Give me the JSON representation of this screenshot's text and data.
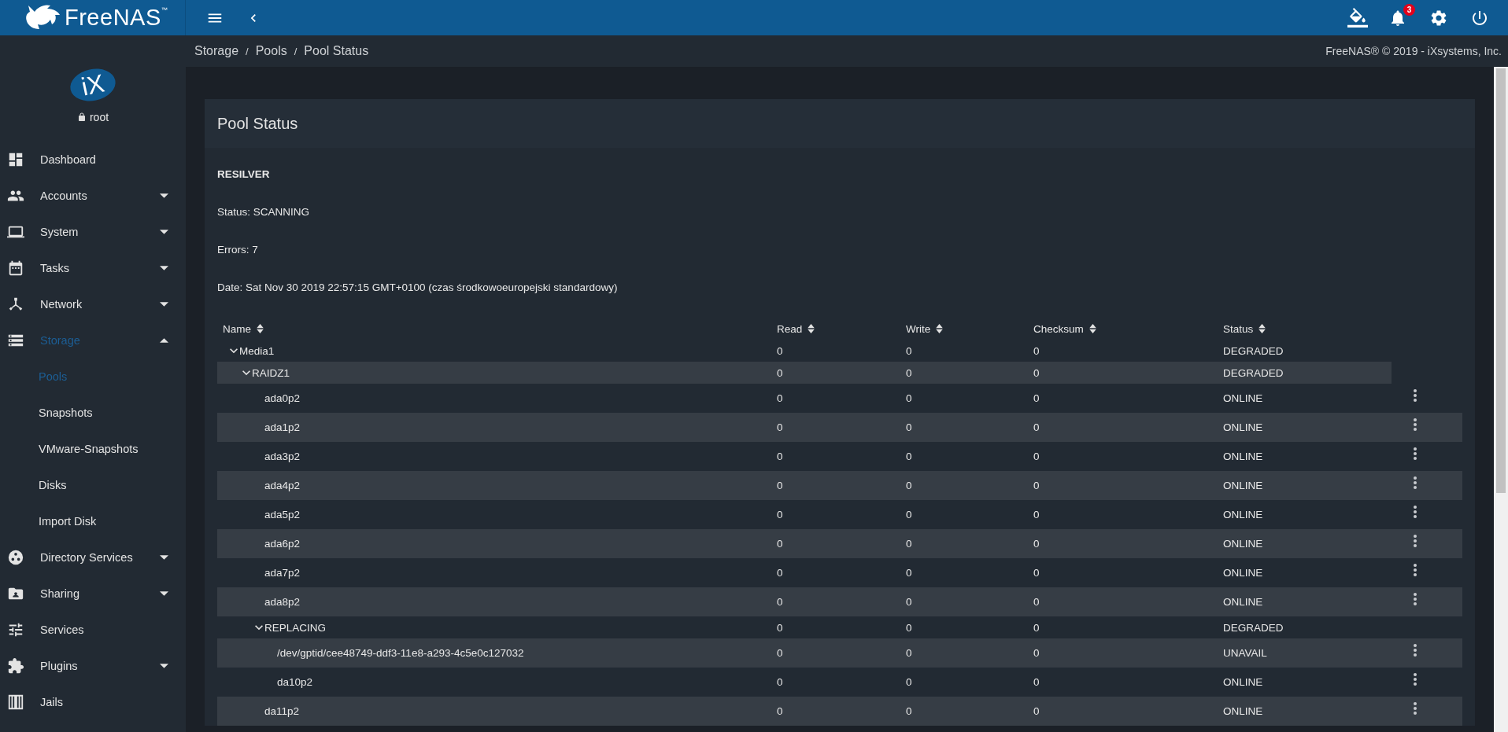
{
  "topbar": {
    "logo_text": "FreeNAS",
    "logo_mark": "™",
    "notification_count": "3"
  },
  "breadcrumbs": {
    "items": [
      "Storage",
      "Pools",
      "Pool Status"
    ],
    "separator": "/"
  },
  "copyright": "FreeNAS® © 2019 - iXsystems, Inc.",
  "sidebar": {
    "logo_text": "iX",
    "user": "root",
    "items": [
      {
        "label": "Dashboard",
        "selected": false
      },
      {
        "label": "Accounts",
        "selected": false,
        "expanded": false
      },
      {
        "label": "System",
        "selected": false,
        "expanded": false
      },
      {
        "label": "Tasks",
        "selected": false,
        "expanded": false
      },
      {
        "label": "Network",
        "selected": false,
        "expanded": false
      },
      {
        "label": "Storage",
        "selected": true,
        "expanded": true,
        "children": [
          {
            "label": "Pools",
            "selected": true
          },
          {
            "label": "Snapshots",
            "selected": false
          },
          {
            "label": "VMware-Snapshots",
            "selected": false
          },
          {
            "label": "Disks",
            "selected": false
          },
          {
            "label": "Import Disk",
            "selected": false
          }
        ]
      },
      {
        "label": "Directory Services",
        "selected": false,
        "expanded": false
      },
      {
        "label": "Sharing",
        "selected": false,
        "expanded": false
      },
      {
        "label": "Services",
        "selected": false
      },
      {
        "label": "Plugins",
        "selected": false,
        "expanded": false
      },
      {
        "label": "Jails",
        "selected": false
      }
    ]
  },
  "pool": {
    "title": "Pool Status",
    "info": [
      {
        "kind": "heading",
        "text": "RESILVER"
      },
      {
        "kind": "line",
        "text": "Status: SCANNING"
      },
      {
        "kind": "line",
        "text": "Errors: 7"
      },
      {
        "kind": "line",
        "text": "Date: Sat Nov 30 2019 22:57:15 GMT+0100 (czas środkowoeuropejski standardowy)"
      }
    ],
    "columns": [
      "Name",
      "Read",
      "Write",
      "Checksum",
      "Status"
    ],
    "rows": [
      {
        "name": "Media1",
        "read": "0",
        "write": "0",
        "checksum": "0",
        "status": "DEGRADED",
        "expanded": true,
        "children": [
          {
            "name": "RAIDZ1",
            "read": "0",
            "write": "0",
            "checksum": "0",
            "status": "DEGRADED",
            "expanded": true,
            "children": [
              {
                "name": "ada0p2",
                "read": "0",
                "write": "0",
                "checksum": "0",
                "status": "ONLINE"
              },
              {
                "name": "ada1p2",
                "read": "0",
                "write": "0",
                "checksum": "0",
                "status": "ONLINE"
              },
              {
                "name": "ada3p2",
                "read": "0",
                "write": "0",
                "checksum": "0",
                "status": "ONLINE"
              },
              {
                "name": "ada4p2",
                "read": "0",
                "write": "0",
                "checksum": "0",
                "status": "ONLINE"
              },
              {
                "name": "ada5p2",
                "read": "0",
                "write": "0",
                "checksum": "0",
                "status": "ONLINE"
              },
              {
                "name": "ada6p2",
                "read": "0",
                "write": "0",
                "checksum": "0",
                "status": "ONLINE"
              },
              {
                "name": "ada7p2",
                "read": "0",
                "write": "0",
                "checksum": "0",
                "status": "ONLINE"
              },
              {
                "name": "ada8p2",
                "read": "0",
                "write": "0",
                "checksum": "0",
                "status": "ONLINE"
              },
              {
                "name": "REPLACING",
                "read": "0",
                "write": "0",
                "checksum": "0",
                "status": "DEGRADED",
                "expanded": true,
                "children": [
                  {
                    "name": "/dev/gptid/cee48749-ddf3-11e8-a293-4c5e0c127032",
                    "read": "0",
                    "write": "0",
                    "checksum": "0",
                    "status": "UNAVAIL"
                  },
                  {
                    "name": "da10p2",
                    "read": "0",
                    "write": "0",
                    "checksum": "0",
                    "status": "ONLINE"
                  }
                ]
              },
              {
                "name": "da11p2",
                "read": "0",
                "write": "0",
                "checksum": "0",
                "status": "ONLINE"
              }
            ]
          }
        ]
      }
    ]
  }
}
